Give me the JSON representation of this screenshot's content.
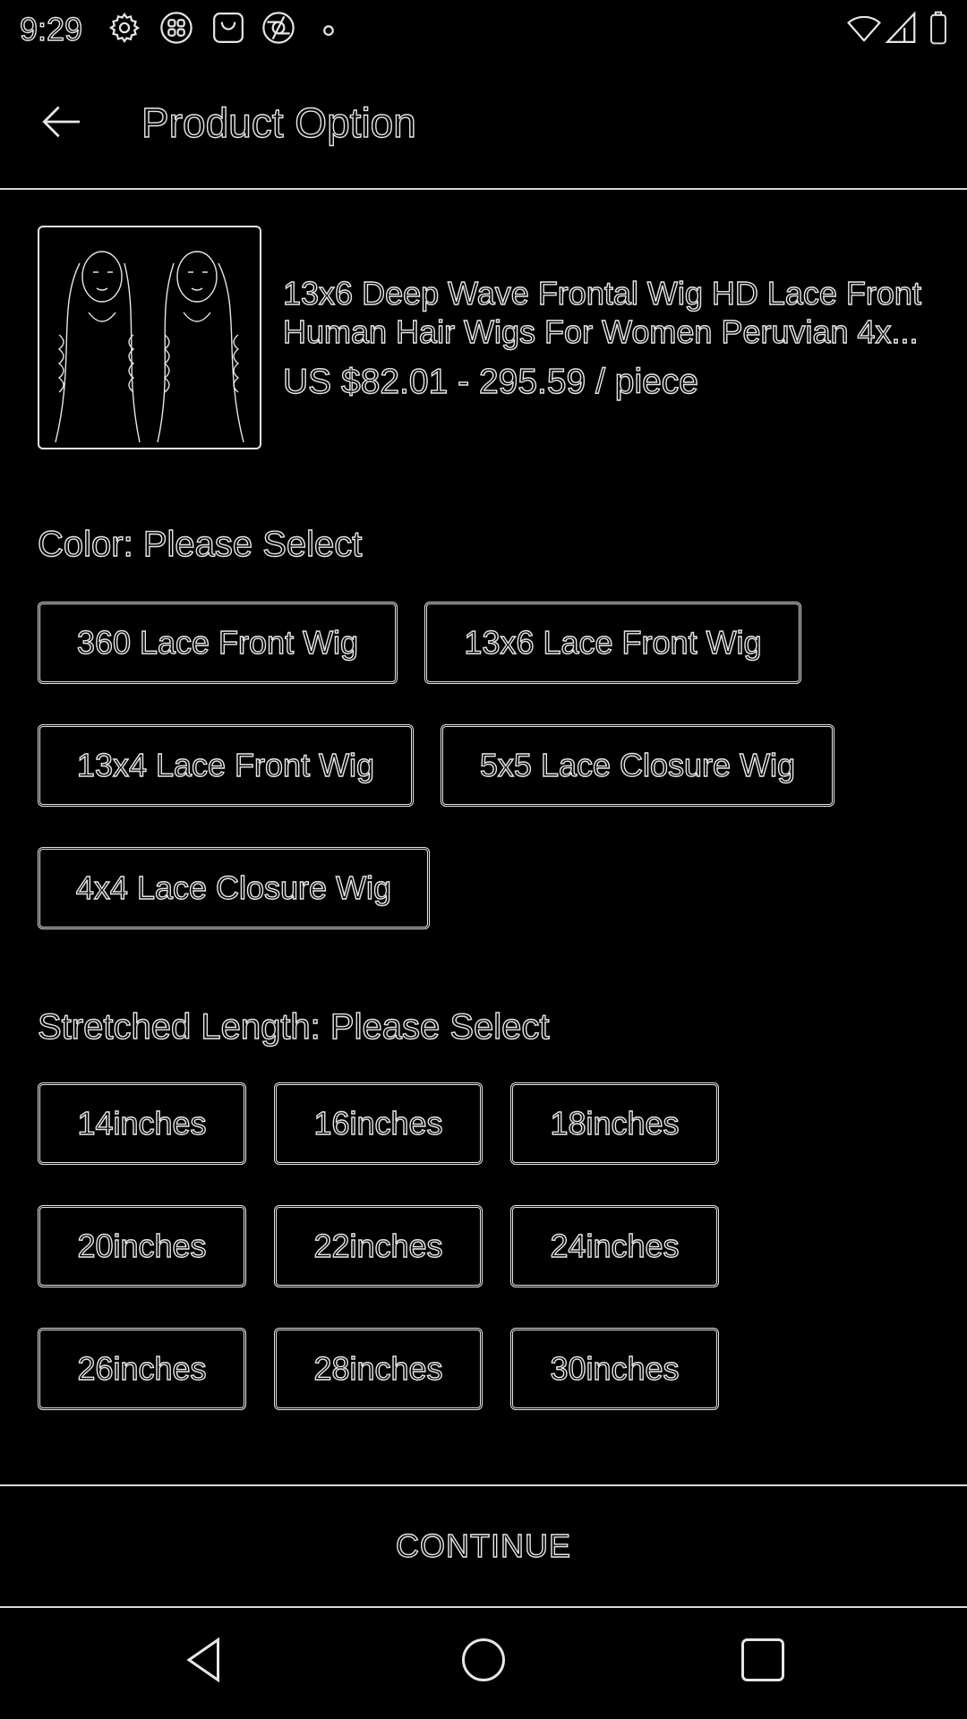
{
  "status_bar": {
    "time": "9:29",
    "icons_left": [
      "gear-icon",
      "app-grid-icon",
      "shopping-bag-icon",
      "aperture-icon",
      "dot-icon"
    ],
    "icons_right": [
      "wifi-icon",
      "signal-icon",
      "battery-icon"
    ]
  },
  "toolbar": {
    "title": "Product Option"
  },
  "product": {
    "name_line1": "13x6 Deep Wave Frontal Wig HD Lace Front",
    "name_line2": "Human Hair Wigs For Women Peruvian 4x...",
    "price": "US $82.01 - 295.59 / piece"
  },
  "color": {
    "label": "Color: Please Select",
    "options": [
      "360 Lace Front Wig",
      "13x6 Lace Front Wig",
      "13x4 Lace Front Wig",
      "5x5 Lace Closure Wig",
      "4x4 Lace Closure Wig"
    ]
  },
  "length": {
    "label": "Stretched Length: Please Select",
    "options": [
      "14inches",
      "16inches",
      "18inches",
      "20inches",
      "22inches",
      "24inches",
      "26inches",
      "28inches",
      "30inches"
    ]
  },
  "continue_label": "CONTINUE",
  "colors": {
    "background": "#000000",
    "outline": "#e6e6e6"
  }
}
